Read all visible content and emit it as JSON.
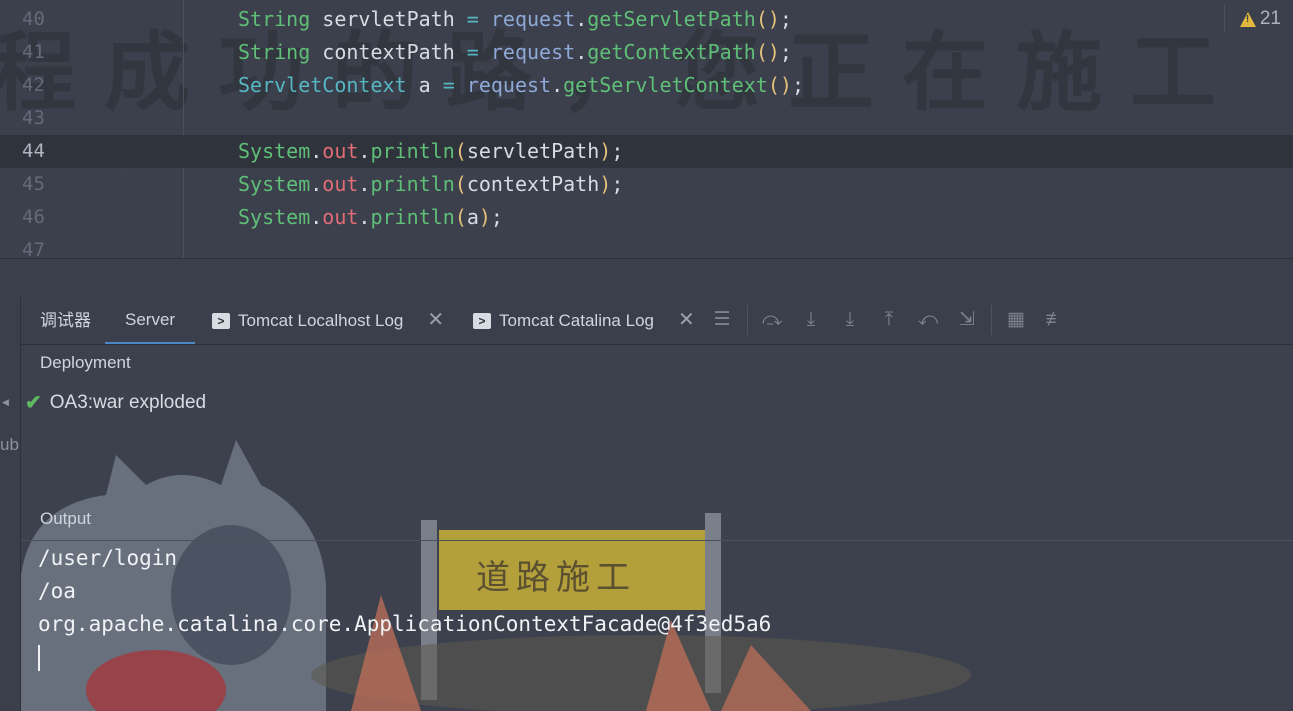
{
  "editor": {
    "warning_count": "21",
    "watermark": "程成功的路，您正在施工",
    "lines": [
      {
        "num": "40",
        "tokens": [
          [
            "t-type",
            "String"
          ],
          [
            "t-var",
            " servletPath "
          ],
          [
            "t-op",
            "="
          ],
          [
            "t-var",
            " "
          ],
          [
            "t-obj",
            "request"
          ],
          [
            "t-dot",
            "."
          ],
          [
            "t-meth",
            "getServletPath"
          ],
          [
            "t-paren",
            "()"
          ],
          [
            "t-dot",
            ";"
          ]
        ]
      },
      {
        "num": "41",
        "tokens": [
          [
            "t-type",
            "String"
          ],
          [
            "t-var",
            " contextPath "
          ],
          [
            "t-op",
            "="
          ],
          [
            "t-var",
            " "
          ],
          [
            "t-obj",
            "request"
          ],
          [
            "t-dot",
            "."
          ],
          [
            "t-meth",
            "getContextPath"
          ],
          [
            "t-paren",
            "()"
          ],
          [
            "t-dot",
            ";"
          ]
        ]
      },
      {
        "num": "42",
        "tokens": [
          [
            "t-type2",
            "ServletContext"
          ],
          [
            "t-var",
            " a "
          ],
          [
            "t-op",
            "="
          ],
          [
            "t-var",
            " "
          ],
          [
            "t-obj",
            "request"
          ],
          [
            "t-dot",
            "."
          ],
          [
            "t-meth",
            "getServletContext"
          ],
          [
            "t-paren",
            "()"
          ],
          [
            "t-dot",
            ";"
          ]
        ]
      },
      {
        "num": "43",
        "tokens": []
      },
      {
        "num": "44",
        "current": true,
        "tokens": [
          [
            "t-type",
            "System"
          ],
          [
            "t-dot",
            "."
          ],
          [
            "t-field",
            "out"
          ],
          [
            "t-dot",
            "."
          ],
          [
            "t-meth",
            "println"
          ],
          [
            "t-paren",
            "("
          ],
          [
            "t-var",
            "servletPath"
          ],
          [
            "t-paren",
            ")"
          ],
          [
            "t-dot",
            ";"
          ]
        ]
      },
      {
        "num": "45",
        "tokens": [
          [
            "t-type",
            "System"
          ],
          [
            "t-dot",
            "."
          ],
          [
            "t-field",
            "out"
          ],
          [
            "t-dot",
            "."
          ],
          [
            "t-meth",
            "println"
          ],
          [
            "t-paren",
            "("
          ],
          [
            "t-var",
            "contextPath"
          ],
          [
            "t-paren",
            ")"
          ],
          [
            "t-dot",
            ";"
          ]
        ]
      },
      {
        "num": "46",
        "tokens": [
          [
            "t-type",
            "System"
          ],
          [
            "t-dot",
            "."
          ],
          [
            "t-field",
            "out"
          ],
          [
            "t-dot",
            "."
          ],
          [
            "t-meth",
            "println"
          ],
          [
            "t-paren",
            "("
          ],
          [
            "t-var",
            "a"
          ],
          [
            "t-paren",
            ")"
          ],
          [
            "t-dot",
            ";"
          ]
        ]
      },
      {
        "num": "47",
        "tokens": []
      }
    ]
  },
  "tool_window": {
    "tabs": {
      "debugger": "调试器",
      "server": "Server",
      "tomcat_localhost": "Tomcat Localhost Log",
      "tomcat_catalina": "Tomcat Catalina Log"
    },
    "left_strip_text": "ub",
    "deployment_header": "Deployment",
    "deployment_item": "OA3:war exploded",
    "output_header": "Output",
    "output_lines": [
      "/user/login",
      "/oa",
      "org.apache.catalina.core.ApplicationContextFacade@4f3ed5a6"
    ],
    "sign_text": "道路施工",
    "colors": {
      "accent_tab": "#4a88c7",
      "success": "#5fb760",
      "warning": "#e2b93d",
      "sign": "#c9b238"
    }
  }
}
